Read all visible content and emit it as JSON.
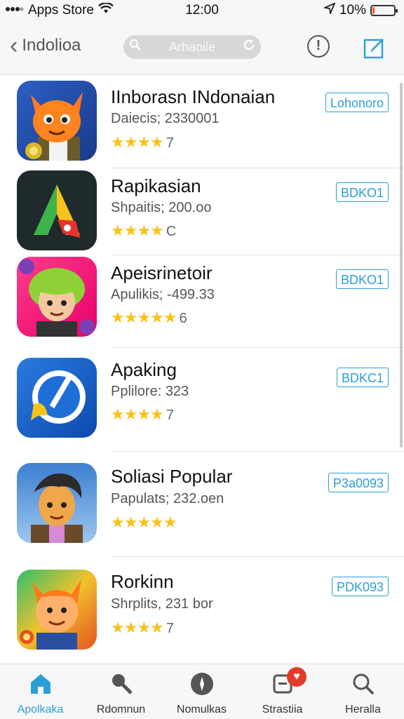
{
  "status_bar": {
    "carrier": "Apps Store",
    "time": "12:00",
    "battery_percent": "10%",
    "battery_level": 0.1
  },
  "nav": {
    "back_label": "Indolioa",
    "search_text": "Arhaoile"
  },
  "apps": [
    {
      "title": "IInborasn INdonaian",
      "subtitle": "Daiecis; 2330001",
      "stars": "★★★★",
      "rating_count": "7",
      "button": "Lohonoro"
    },
    {
      "title": "Rapikasian",
      "subtitle": "Shpaitis; 200.oo",
      "stars": "★★★★",
      "rating_count": "C",
      "button": "BDKO1"
    },
    {
      "title": "Apeisrinetoir",
      "subtitle": "Apulikis; -499.33",
      "stars": "★★★★★",
      "rating_count": "6",
      "button": "BDKO1"
    },
    {
      "title": "Apaking",
      "subtitle": "Pplilore: 323",
      "stars": "★★★★",
      "rating_count": "7",
      "button": "BDKC1"
    },
    {
      "title": "Soliasi Popular",
      "subtitle": "Papulats; 232.oen",
      "stars": "★★★★★",
      "rating_count": "",
      "button": "P3a0093"
    },
    {
      "title": "Rorkinn",
      "subtitle": "Shrplits, 231 bor",
      "stars": "★★★★",
      "rating_count": "7",
      "button": "PDK093"
    }
  ],
  "tabs": [
    {
      "label": "Apolkaka",
      "icon": "home-icon"
    },
    {
      "label": "Rdomnun",
      "icon": "search-key-icon"
    },
    {
      "label": "Nomulkas",
      "icon": "compass-icon"
    },
    {
      "label": "Strastiia",
      "icon": "heart-box-icon",
      "badge": "♥"
    },
    {
      "label": "Heralla",
      "icon": "search-icon"
    }
  ],
  "colors": {
    "accent": "#2a9fd6",
    "star": "#f7c21b",
    "badge": "#e23a2b"
  }
}
